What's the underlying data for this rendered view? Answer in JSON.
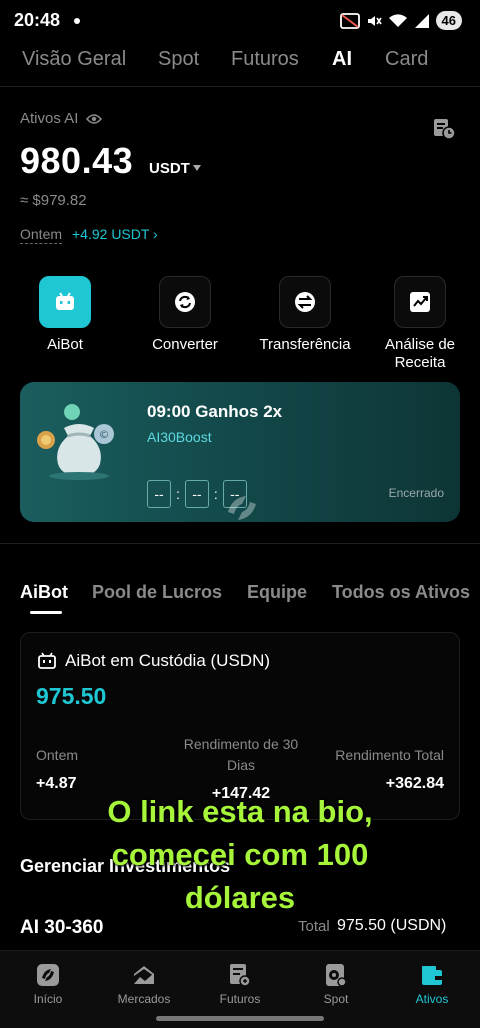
{
  "status_bar": {
    "time": "20:48",
    "battery": "46"
  },
  "top_tabs": [
    "Visão Geral",
    "Spot",
    "Futuros",
    "AI",
    "Card"
  ],
  "top_tabs_active": "AI",
  "assets": {
    "label": "Ativos AI",
    "balance": "980.43",
    "unit": "USDT",
    "approx": "≈ $979.82",
    "yesterday_label": "Ontem",
    "yesterday_value": "+4.92 USDT ›"
  },
  "actions": [
    {
      "label": "AiBot",
      "icon": "robot-icon"
    },
    {
      "label": "Converter",
      "icon": "convert-icon"
    },
    {
      "label": "Transferência",
      "icon": "transfer-icon"
    },
    {
      "label": "Análise de\nReceita",
      "icon": "chart-icon"
    }
  ],
  "banner": {
    "title": "09:00  Ganhos 2x",
    "subtitle": "AI30Boost",
    "countdown": [
      "--",
      "--",
      "--"
    ],
    "status": "Encerrado"
  },
  "sub_tabs": [
    "AiBot",
    "Pool de Lucros",
    "Equipe",
    "Todos os Ativos"
  ],
  "sub_tabs_active": "AiBot",
  "custody": {
    "title": "AiBot em Custódia (USDN)",
    "amount": "975.50",
    "stats": [
      {
        "label": "Ontem",
        "value": "+4.87"
      },
      {
        "label": "Rendimento de 30\nDias",
        "value": "+147.42"
      },
      {
        "label": "Rendimento Total",
        "value": "+362.84"
      }
    ]
  },
  "manage": {
    "title": "Gerenciar Investimentos",
    "plan_name": "AI 30-360",
    "total_label": "Total",
    "total_value": "975.50 (USDN)"
  },
  "overlay_caption": "O link esta na bio,\ncomecei com 100\ndólares",
  "bottom_nav": [
    {
      "label": "Início",
      "icon": "home-icon"
    },
    {
      "label": "Mercados",
      "icon": "markets-icon"
    },
    {
      "label": "Futuros",
      "icon": "futures-icon"
    },
    {
      "label": "Spot",
      "icon": "spot-icon"
    },
    {
      "label": "Ativos",
      "icon": "wallet-icon"
    }
  ],
  "bottom_nav_active": "Ativos",
  "colors": {
    "accent": "#1fc7d4",
    "caption": "#a6f53a",
    "background": "#000000"
  }
}
